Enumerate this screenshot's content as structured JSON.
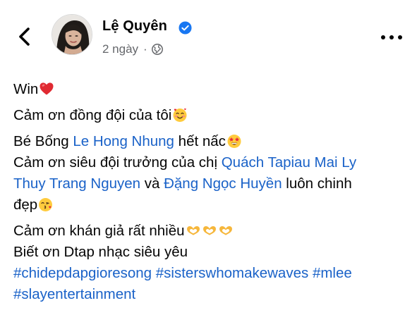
{
  "post": {
    "author": "Lệ Quyên",
    "timestamp": "2 ngày",
    "meta_separator": "·",
    "line1": {
      "text": "Win"
    },
    "line2": {
      "text": "Cảm ơn đồng đội của tôi"
    },
    "line3": {
      "prefix": "Bé Bống ",
      "mention": "Le Hong Nhung",
      "suffix": " hết nấc"
    },
    "line4": {
      "prefix": "Cảm ơn siêu đội trưởng của chị ",
      "mention": "Quách Tapiau Mai Ly"
    },
    "line5": {
      "mention1": "Thuy Trang Nguyen",
      "middle": " và ",
      "mention2": "Đặng Ngọc Huyền",
      "suffix": " luôn chinh"
    },
    "line6": {
      "text": "đẹp"
    },
    "line7": {
      "text": "Cảm ơn khán giả rất nhiều"
    },
    "line8": {
      "text": "Biết ơn Dtap nhạc siêu yêu"
    },
    "hashtags": {
      "tag1": "#chidepdapgioresong",
      "tag2": "#sisterswhomakewaves",
      "tag3": "#mlee",
      "tag4": "#slayentertainment"
    }
  },
  "icons": {
    "back": "chevron-left-icon",
    "verified": "verified-badge-icon",
    "audience": "globe-icon",
    "more": "more-horizontal-icon"
  },
  "colors": {
    "link": "#1a62c8",
    "verified": "#1877f2",
    "meta": "#65676b",
    "text": "#050505"
  }
}
